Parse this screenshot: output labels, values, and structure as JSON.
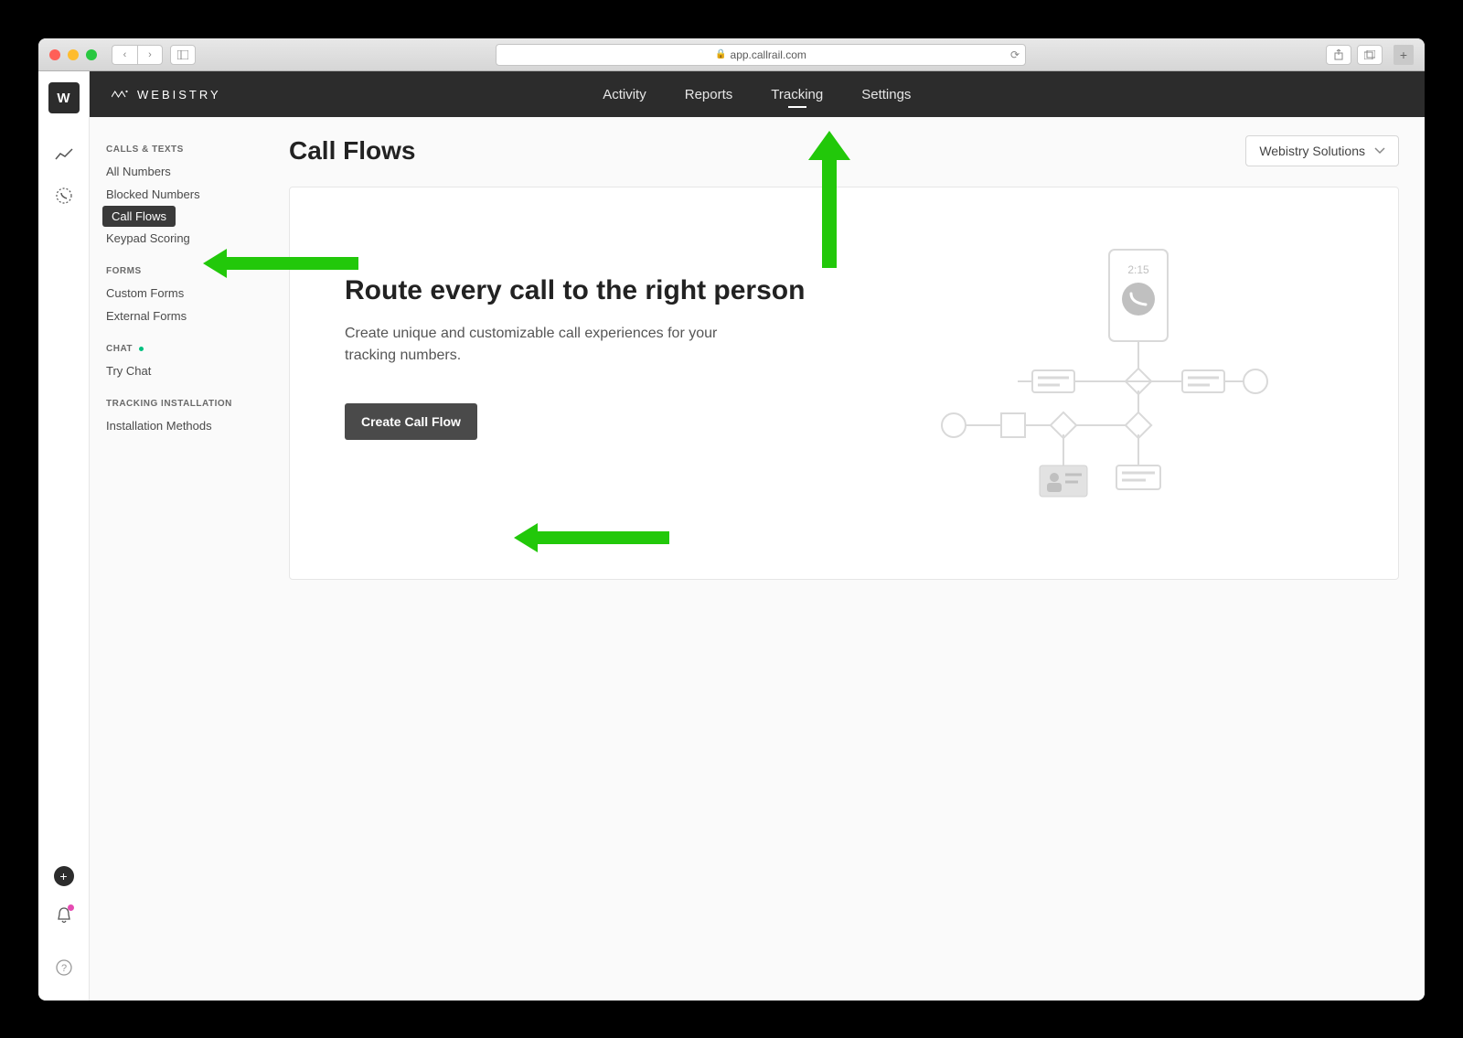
{
  "browser": {
    "url": "app.callrail.com"
  },
  "brand": "WEBISTRY",
  "rail": {
    "logo_letter": "W"
  },
  "topnav": {
    "items": [
      {
        "label": "Activity",
        "active": false
      },
      {
        "label": "Reports",
        "active": false
      },
      {
        "label": "Tracking",
        "active": true
      },
      {
        "label": "Settings",
        "active": false
      }
    ]
  },
  "sidebar": {
    "sections": [
      {
        "title": "CALLS & TEXTS",
        "items": [
          {
            "label": "All Numbers",
            "active": false
          },
          {
            "label": "Blocked Numbers",
            "active": false
          },
          {
            "label": "Call Flows",
            "active": true
          },
          {
            "label": "Keypad Scoring",
            "active": false
          }
        ]
      },
      {
        "title": "FORMS",
        "items": [
          {
            "label": "Custom Forms",
            "active": false
          },
          {
            "label": "External Forms",
            "active": false
          }
        ]
      },
      {
        "title": "CHAT",
        "indicator": true,
        "items": [
          {
            "label": "Try Chat",
            "active": false
          }
        ]
      },
      {
        "title": "TRACKING INSTALLATION",
        "items": [
          {
            "label": "Installation Methods",
            "active": false
          }
        ]
      }
    ]
  },
  "page": {
    "title": "Call Flows",
    "account_selector": "Webistry Solutions",
    "hero_title": "Route every call to the right person",
    "hero_desc": "Create unique and customizable call experiences for your tracking numbers.",
    "create_button": "Create Call Flow",
    "phone_time": "2:15"
  },
  "colors": {
    "arrow": "#22c80a",
    "topbar": "#2c2c2c"
  }
}
